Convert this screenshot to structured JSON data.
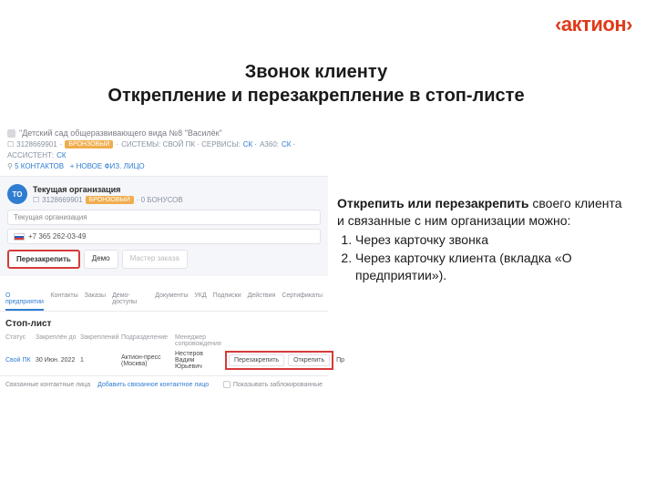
{
  "brand": "‹актион›",
  "title_line1": "Звонок клиенту",
  "title_line2": "Открепление и перезакрепление в стоп-листе",
  "right": {
    "bold": "Открепить или перезакрепить",
    "rest": " своего клиента и связанные с ним организации можно:",
    "items": [
      "Через карточку звонка",
      "Через карточку клиента (вкладка «О предприятии»)."
    ]
  },
  "card1": {
    "orgname": "\"Детский сад общеразвивающего вида №8 \"Василёк\"",
    "id_row": {
      "box": "☐",
      "id": "3128669901",
      "sep": "·",
      "badge": "БРОНЗОВЫЙ",
      "sys": "СИСТЕМЫ: СВОЙ ПК · СЕРВИСЫ:",
      "sk": "СК ·",
      "a360_lbl": "А360:",
      "a360": "СК ·",
      "assist_lbl": "АССИСТЕНТ:",
      "assist": "СК"
    },
    "contacts_row": {
      "person": "⚲",
      "contacts": "5 КОНТАКТОВ",
      "new_fiz": "+ НОВОЕ ФИЗ. ЛИЦО"
    },
    "avatar": "ТО",
    "cur_org": "Текущая организация",
    "org_id_row": {
      "box": "☐",
      "id": "3128669901",
      "badge": "БРОНЗОВЫЙ",
      "bonus": "· 0 БОНУСОВ"
    },
    "field_placeholder": "Текущая организация",
    "phone": "+7 365 262-03-49",
    "actions": {
      "reattach": "Перезакрепить",
      "demo": "Демо",
      "wizard": "Мастер заказа"
    }
  },
  "card2": {
    "tabs": [
      "О предприятии",
      "Контакты",
      "Заказы",
      "Демо-доступы",
      "Документы",
      "УКД",
      "Подписки",
      "Действия",
      "Сертификаты"
    ],
    "stop_title": "Стоп-лист",
    "headers": [
      "Статус",
      "Закреплён до",
      "Закреплений",
      "Подразделение",
      "Менеджер сопровождения",
      ""
    ],
    "row": {
      "status": "Свой ПК",
      "until": "30 Июн. 2022",
      "count": "1",
      "unit": "Актион-пресс (Москва)",
      "manager": "Нестеров Вадим Юрьевич",
      "btn_reattach": "Перезакрепить",
      "btn_detach": "Открепить",
      "trailing": "Пр"
    },
    "footer": {
      "label": "Связанные контактные лица",
      "add": "Добавить связанное контактное лицо",
      "show_blocked": "Показывать заблокированные"
    }
  }
}
